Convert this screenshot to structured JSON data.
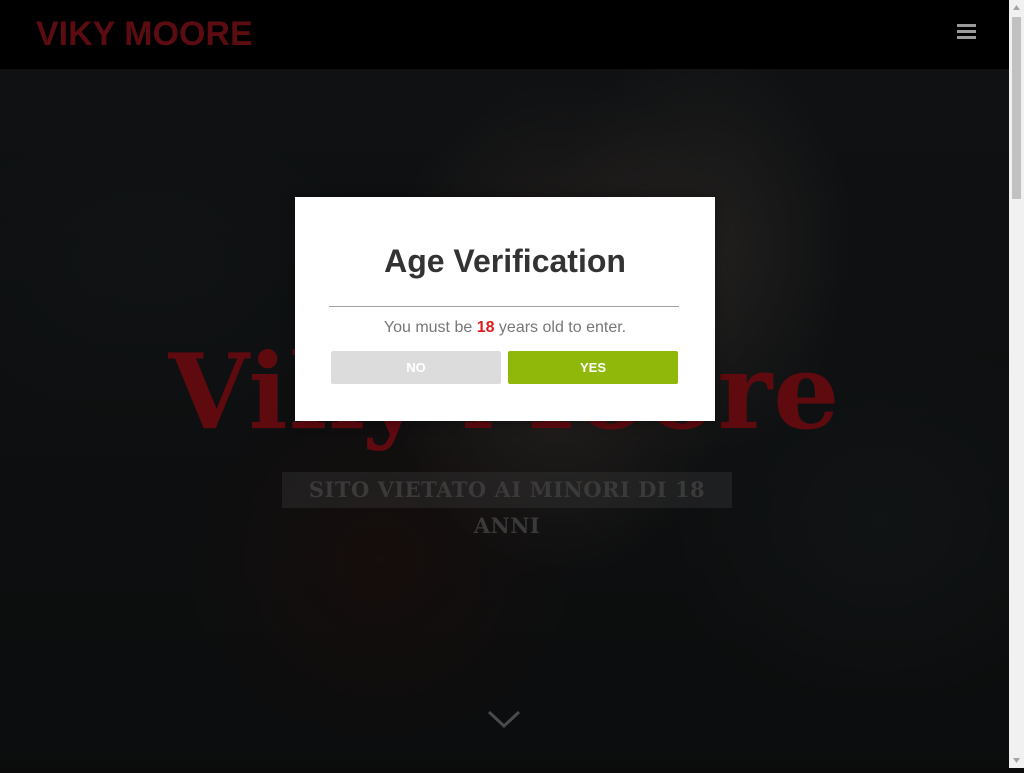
{
  "header": {
    "logo": "VIKY MOORE",
    "menu_icon": "hamburger-menu-icon"
  },
  "hero": {
    "title": "Viky Moore",
    "subtitle": "SITO VIETATO AI MINORI DI 18 ANNI",
    "scroll_icon": "chevron-down-icon"
  },
  "modal": {
    "title": "Age Verification",
    "message_prefix": "You must be ",
    "age": "18",
    "message_suffix": " years old to enter.",
    "no_label": "NO",
    "yes_label": "YES"
  },
  "colors": {
    "accent_red": "#e01b1b",
    "yes_green": "#8fb80b",
    "no_gray": "#dcdcdc",
    "logo_red": "#5a0c10"
  }
}
